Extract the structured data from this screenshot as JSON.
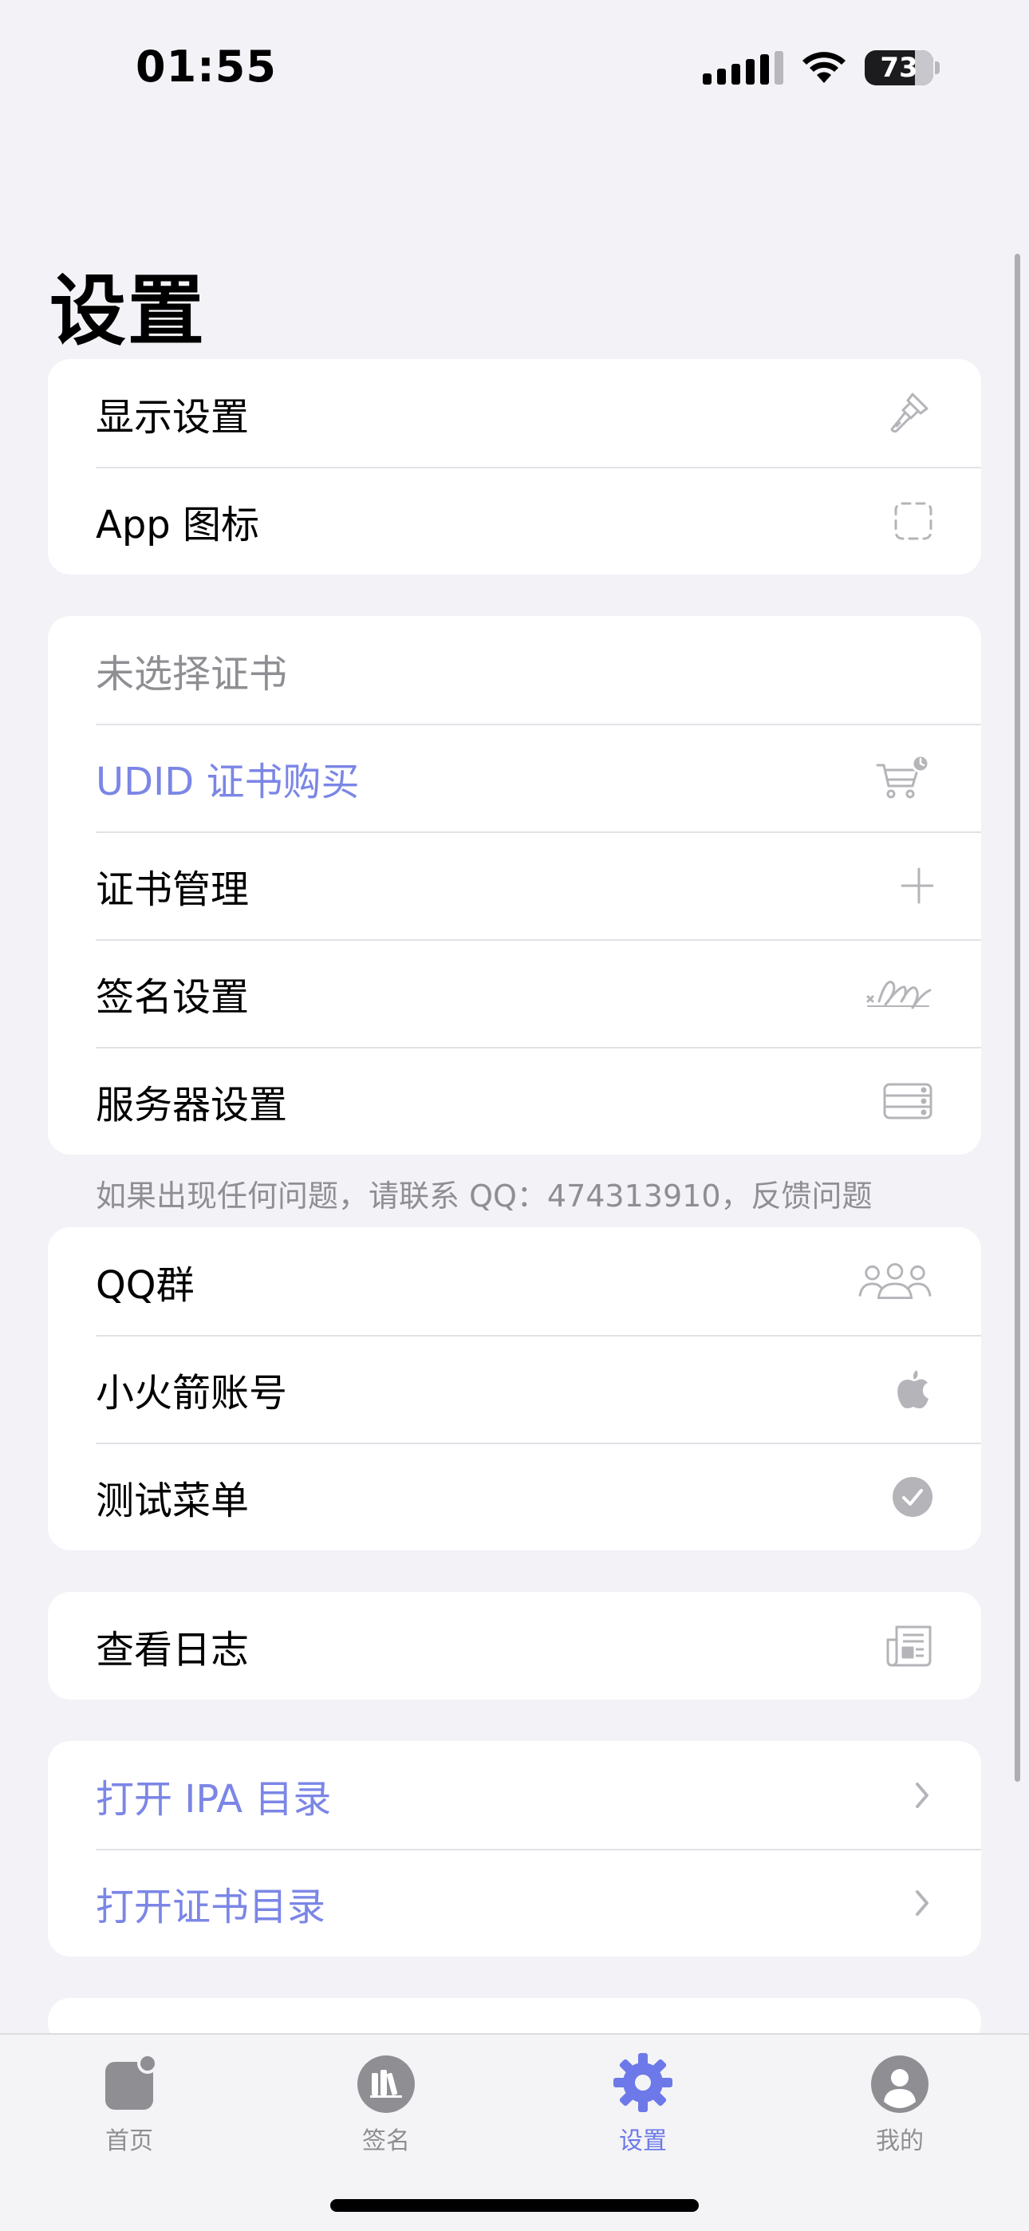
{
  "status_bar": {
    "time": "01:55",
    "battery_level": "73"
  },
  "page": {
    "title": "设置"
  },
  "groups": {
    "display": {
      "items": [
        {
          "label": "显示设置",
          "icon": "paintbrush-icon"
        },
        {
          "label": "App 图标",
          "icon": "dashed-square-icon"
        }
      ]
    },
    "certificate": {
      "items": [
        {
          "label": "未选择证书"
        },
        {
          "label": "UDID 证书购买",
          "icon": "cart-clock-icon"
        },
        {
          "label": "证书管理",
          "icon": "plus-icon"
        },
        {
          "label": "签名设置",
          "icon": "signature-icon"
        },
        {
          "label": "服务器设置",
          "icon": "server-icon"
        }
      ],
      "footer": "如果出现任何问题，请联系 QQ：474313910，反馈问题"
    },
    "community": {
      "items": [
        {
          "label": "QQ群",
          "icon": "people-group-icon"
        },
        {
          "label": "小火箭账号",
          "icon": "apple-logo-icon"
        },
        {
          "label": "测试菜单",
          "icon": "checkmark-circle-icon"
        }
      ]
    },
    "logs": {
      "items": [
        {
          "label": "查看日志",
          "icon": "newspaper-icon"
        }
      ]
    },
    "directories": {
      "items": [
        {
          "label": "打开 IPA 目录",
          "icon": "chevron-right-icon"
        },
        {
          "label": "打开证书目录",
          "icon": "chevron-right-icon"
        }
      ]
    }
  },
  "tabbar": {
    "tabs": [
      {
        "label": "首页",
        "icon": "app-badge-icon"
      },
      {
        "label": "签名",
        "icon": "books-circle-icon"
      },
      {
        "label": "设置",
        "icon": "gear-icon",
        "active": true
      },
      {
        "label": "我的",
        "icon": "person-circle-icon"
      }
    ]
  },
  "colors": {
    "accent": "#6d79e8",
    "accent_text": "#7b86e6",
    "background": "#f2f2f7",
    "secondary_text": "#8e8e93"
  }
}
